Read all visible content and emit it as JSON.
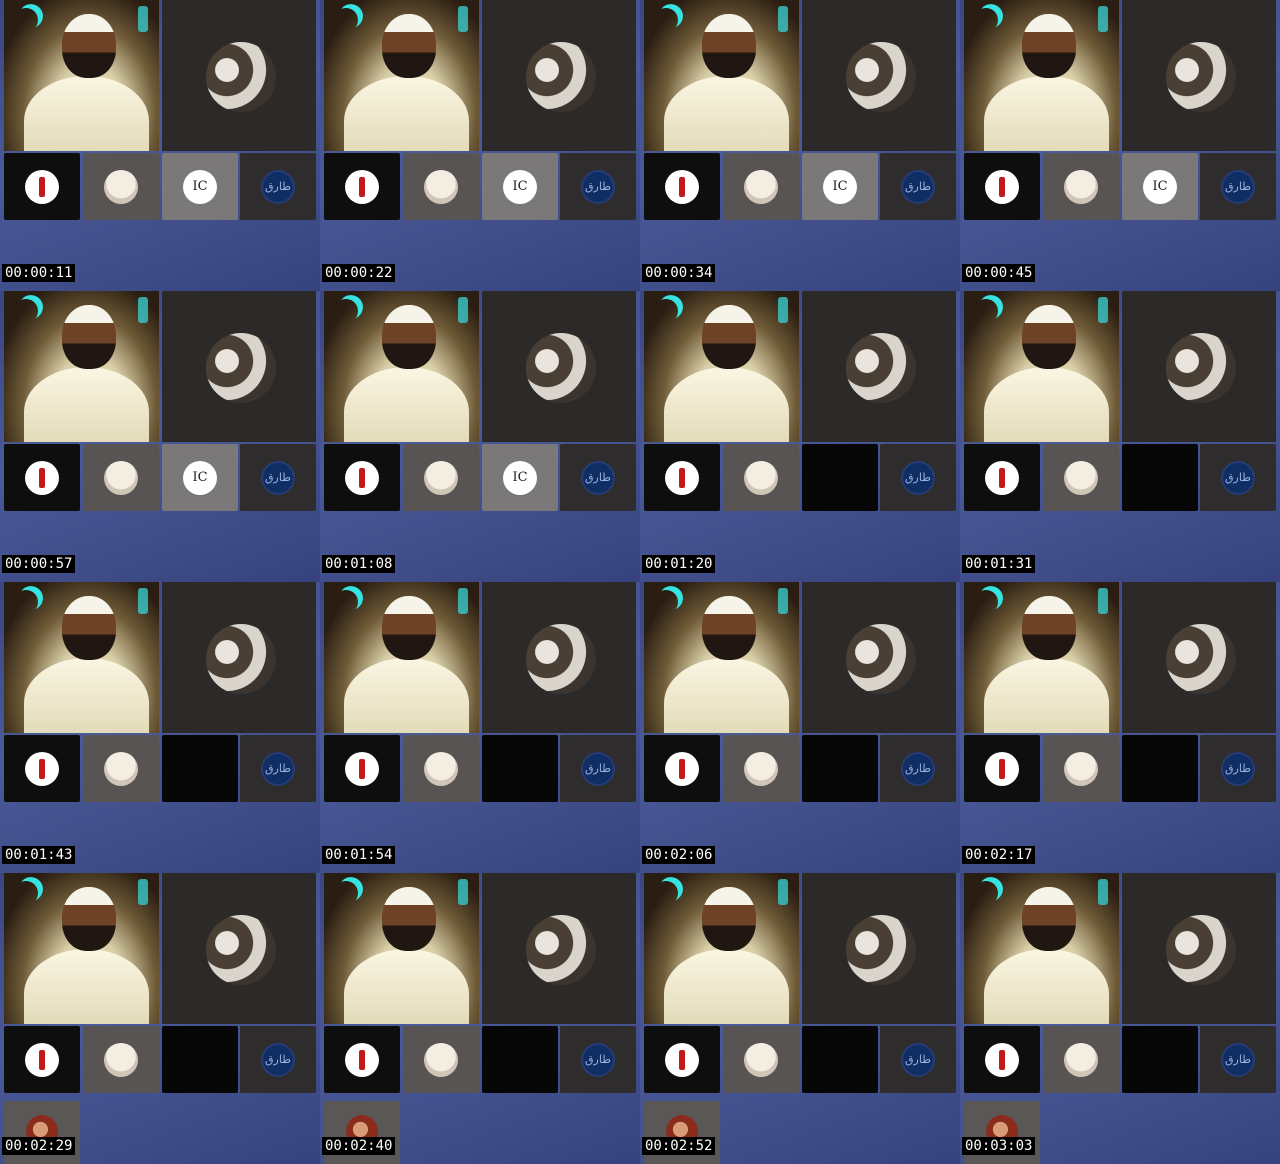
{
  "frames": [
    {
      "timestamp": "00:00:11",
      "ic_logo_text": "IC",
      "tariq_logo_text": "طارق",
      "third_tile_state": "logo",
      "extra_participant": false
    },
    {
      "timestamp": "00:00:22",
      "ic_logo_text": "IC",
      "tariq_logo_text": "طارق",
      "third_tile_state": "logo",
      "extra_participant": false
    },
    {
      "timestamp": "00:00:34",
      "ic_logo_text": "IC",
      "tariq_logo_text": "طارق",
      "third_tile_state": "logo",
      "extra_participant": false
    },
    {
      "timestamp": "00:00:45",
      "ic_logo_text": "IC",
      "tariq_logo_text": "طارق",
      "third_tile_state": "logo",
      "extra_participant": false
    },
    {
      "timestamp": "00:00:57",
      "ic_logo_text": "IC",
      "tariq_logo_text": "طارق",
      "third_tile_state": "logo",
      "extra_participant": false
    },
    {
      "timestamp": "00:01:08",
      "ic_logo_text": "IC",
      "tariq_logo_text": "طارق",
      "third_tile_state": "logo",
      "extra_participant": false
    },
    {
      "timestamp": "00:01:20",
      "ic_logo_text": "",
      "tariq_logo_text": "طارق",
      "third_tile_state": "off",
      "extra_participant": false
    },
    {
      "timestamp": "00:01:31",
      "ic_logo_text": "",
      "tariq_logo_text": "طارق",
      "third_tile_state": "off",
      "extra_participant": false
    },
    {
      "timestamp": "00:01:43",
      "ic_logo_text": "",
      "tariq_logo_text": "طارق",
      "third_tile_state": "off",
      "extra_participant": false
    },
    {
      "timestamp": "00:01:54",
      "ic_logo_text": "",
      "tariq_logo_text": "طارق",
      "third_tile_state": "off",
      "extra_participant": false
    },
    {
      "timestamp": "00:02:06",
      "ic_logo_text": "",
      "tariq_logo_text": "طارق",
      "third_tile_state": "off",
      "extra_participant": false
    },
    {
      "timestamp": "00:02:17",
      "ic_logo_text": "",
      "tariq_logo_text": "طارق",
      "third_tile_state": "off",
      "extra_participant": false
    },
    {
      "timestamp": "00:02:29",
      "ic_logo_text": "",
      "tariq_logo_text": "طارق",
      "third_tile_state": "off",
      "extra_participant": true
    },
    {
      "timestamp": "00:02:40",
      "ic_logo_text": "",
      "tariq_logo_text": "طارق",
      "third_tile_state": "off",
      "extra_participant": true
    },
    {
      "timestamp": "00:02:52",
      "ic_logo_text": "",
      "tariq_logo_text": "طارق",
      "third_tile_state": "off",
      "extra_participant": true
    },
    {
      "timestamp": "00:03:03",
      "ic_logo_text": "",
      "tariq_logo_text": "طارق",
      "third_tile_state": "off",
      "extra_participant": true
    }
  ],
  "colors": {
    "background": "#3c4a86",
    "tile_dark": "#2c2a29",
    "accent_moon": "#37e3e0",
    "timestamp_bg": "#000000",
    "timestamp_fg": "#ffffff"
  }
}
